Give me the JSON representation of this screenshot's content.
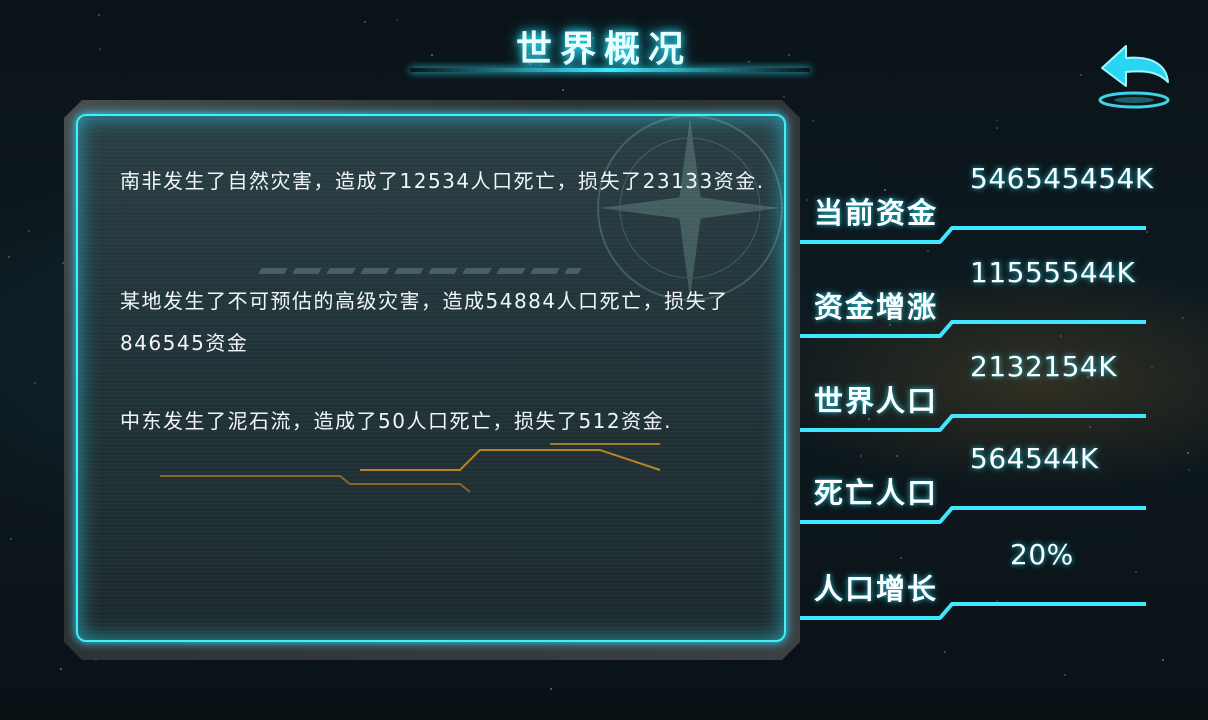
{
  "title": "世界概况",
  "back_icon": "back-arrow-icon",
  "accent_color": "#3fe8ff",
  "events": [
    "南非发生了自然灾害，造成了12534人口死亡，损失了23133资金.",
    "某地发生了不可预估的高级灾害，造成54884人口死亡，损失了846545资金",
    "中东发生了泥石流，造成了50人口死亡，损失了512资金."
  ],
  "stats": [
    {
      "label": "当前资金",
      "value": "546545454K"
    },
    {
      "label": "资金增涨",
      "value": "11555544K"
    },
    {
      "label": "世界人口",
      "value": "2132154K"
    },
    {
      "label": "死亡人口",
      "value": "564544K"
    },
    {
      "label": "人口增长",
      "value": "20%"
    }
  ]
}
